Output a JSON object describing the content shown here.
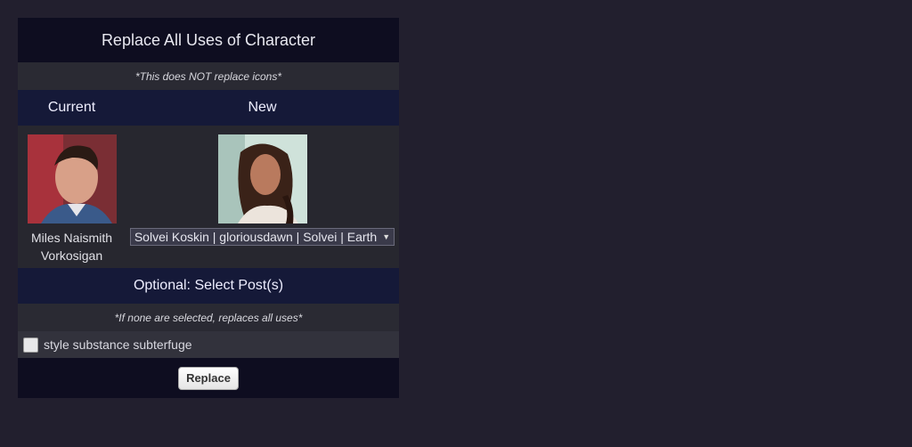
{
  "title": "Replace All Uses of Character",
  "note": "*This does NOT replace icons*",
  "columns": {
    "current": "Current",
    "new": "New"
  },
  "current_character": {
    "name_line1": "Miles Naismith",
    "name_line2": "Vorkosigan"
  },
  "new_character": {
    "selected": "Solvei Koskin | gloriousdawn | Solvei | Earth"
  },
  "optional_heading": "Optional: Select Post(s)",
  "optional_note": "*If none are selected, replaces all uses*",
  "posts": [
    {
      "label": "style substance subterfuge",
      "checked": false
    }
  ],
  "replace_button": "Replace",
  "colors": {
    "background": "#221f2e",
    "title_bar": "#0e0d20",
    "header_bar": "#151938"
  }
}
